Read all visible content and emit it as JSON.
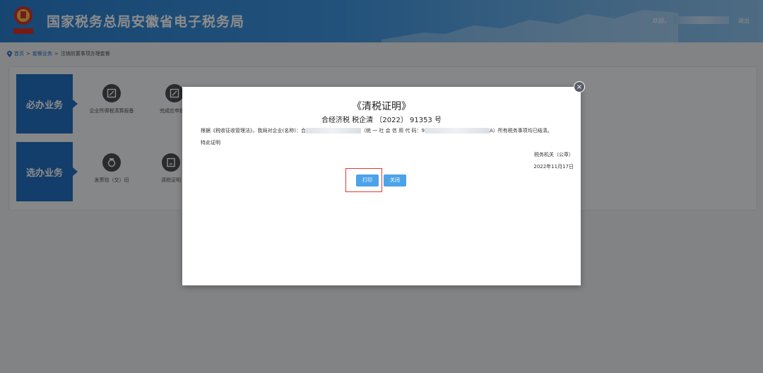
{
  "header": {
    "title": "国家税务总局安徽省电子税务局",
    "welcome": "欢迎，",
    "logout": "退出"
  },
  "breadcrumb": {
    "home": "首页",
    "sep": ">",
    "level2": "套餐业务",
    "level3": "注销前置事项办理套餐"
  },
  "categories": {
    "required": "必办业务",
    "optional": "选办业务"
  },
  "services": {
    "required": [
      {
        "label": "企业所得税清算报备"
      },
      {
        "label": "完成应申报款"
      }
    ],
    "optional": [
      {
        "label": "发票验（交）旧"
      },
      {
        "label": "清税证明"
      }
    ]
  },
  "modal": {
    "title": "《清税证明》",
    "number": "合经济税 税企清 〔2022〕 91353 号",
    "body_prefix": "根据《税收征收管理法》，我局对企业(名称)：合",
    "body_mid": "（统 一 社 会 信 用 代 码：9",
    "body_suffix": "A）所有税务事项均已结清。",
    "special": "特此证明",
    "org": "税务机关（公章）",
    "date": "2022年11月17日",
    "print_label": "打印",
    "close_label": "关闭",
    "close_icon": "×"
  },
  "colors": {
    "header_blue": "#2a7fd0",
    "category_blue": "#2470c2",
    "button_blue": "#4ba3ea",
    "highlight_red": "#e53935"
  }
}
